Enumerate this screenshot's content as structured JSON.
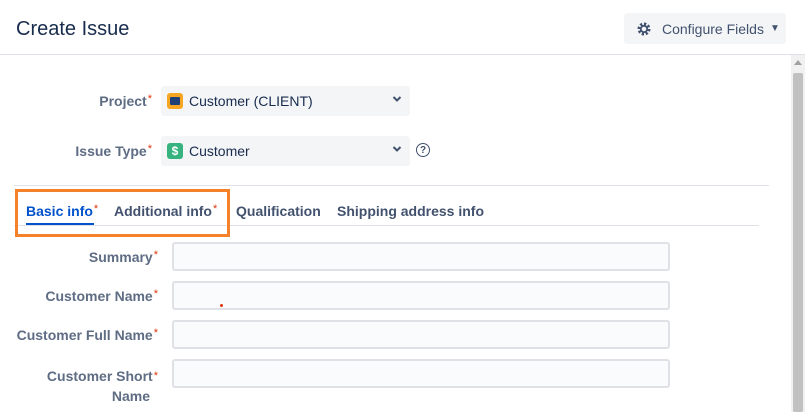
{
  "header": {
    "title": "Create Issue",
    "configure_label": "Configure Fields",
    "icons": [
      "gear-icon",
      "caret-down-icon"
    ]
  },
  "project": {
    "label": "Project",
    "value": "Customer (CLIENT)",
    "icon": "project-avatar-icon"
  },
  "issue_type": {
    "label": "Issue Type",
    "value": "Customer",
    "icon_glyph": "$",
    "help_glyph": "?"
  },
  "required_marker": "*",
  "tabs": [
    {
      "label": "Basic info",
      "required": true,
      "active": true
    },
    {
      "label": "Additional info",
      "required": true,
      "active": false
    },
    {
      "label": "Qualification",
      "required": false,
      "active": false
    },
    {
      "label": "Shipping address info",
      "required": false,
      "active": false
    }
  ],
  "fields": [
    {
      "label": "Summary",
      "value": ""
    },
    {
      "label": "Customer Name",
      "value": ""
    },
    {
      "label": "Customer Full Name",
      "value": ""
    },
    {
      "label_line1": "Customer Short",
      "label_line2": "Name",
      "value": ""
    }
  ],
  "colors": {
    "accent": "#0052cc",
    "required": "#de350b",
    "highlight": "#f5822a",
    "issue_type": "#36b37e",
    "project": "#f6a623"
  }
}
